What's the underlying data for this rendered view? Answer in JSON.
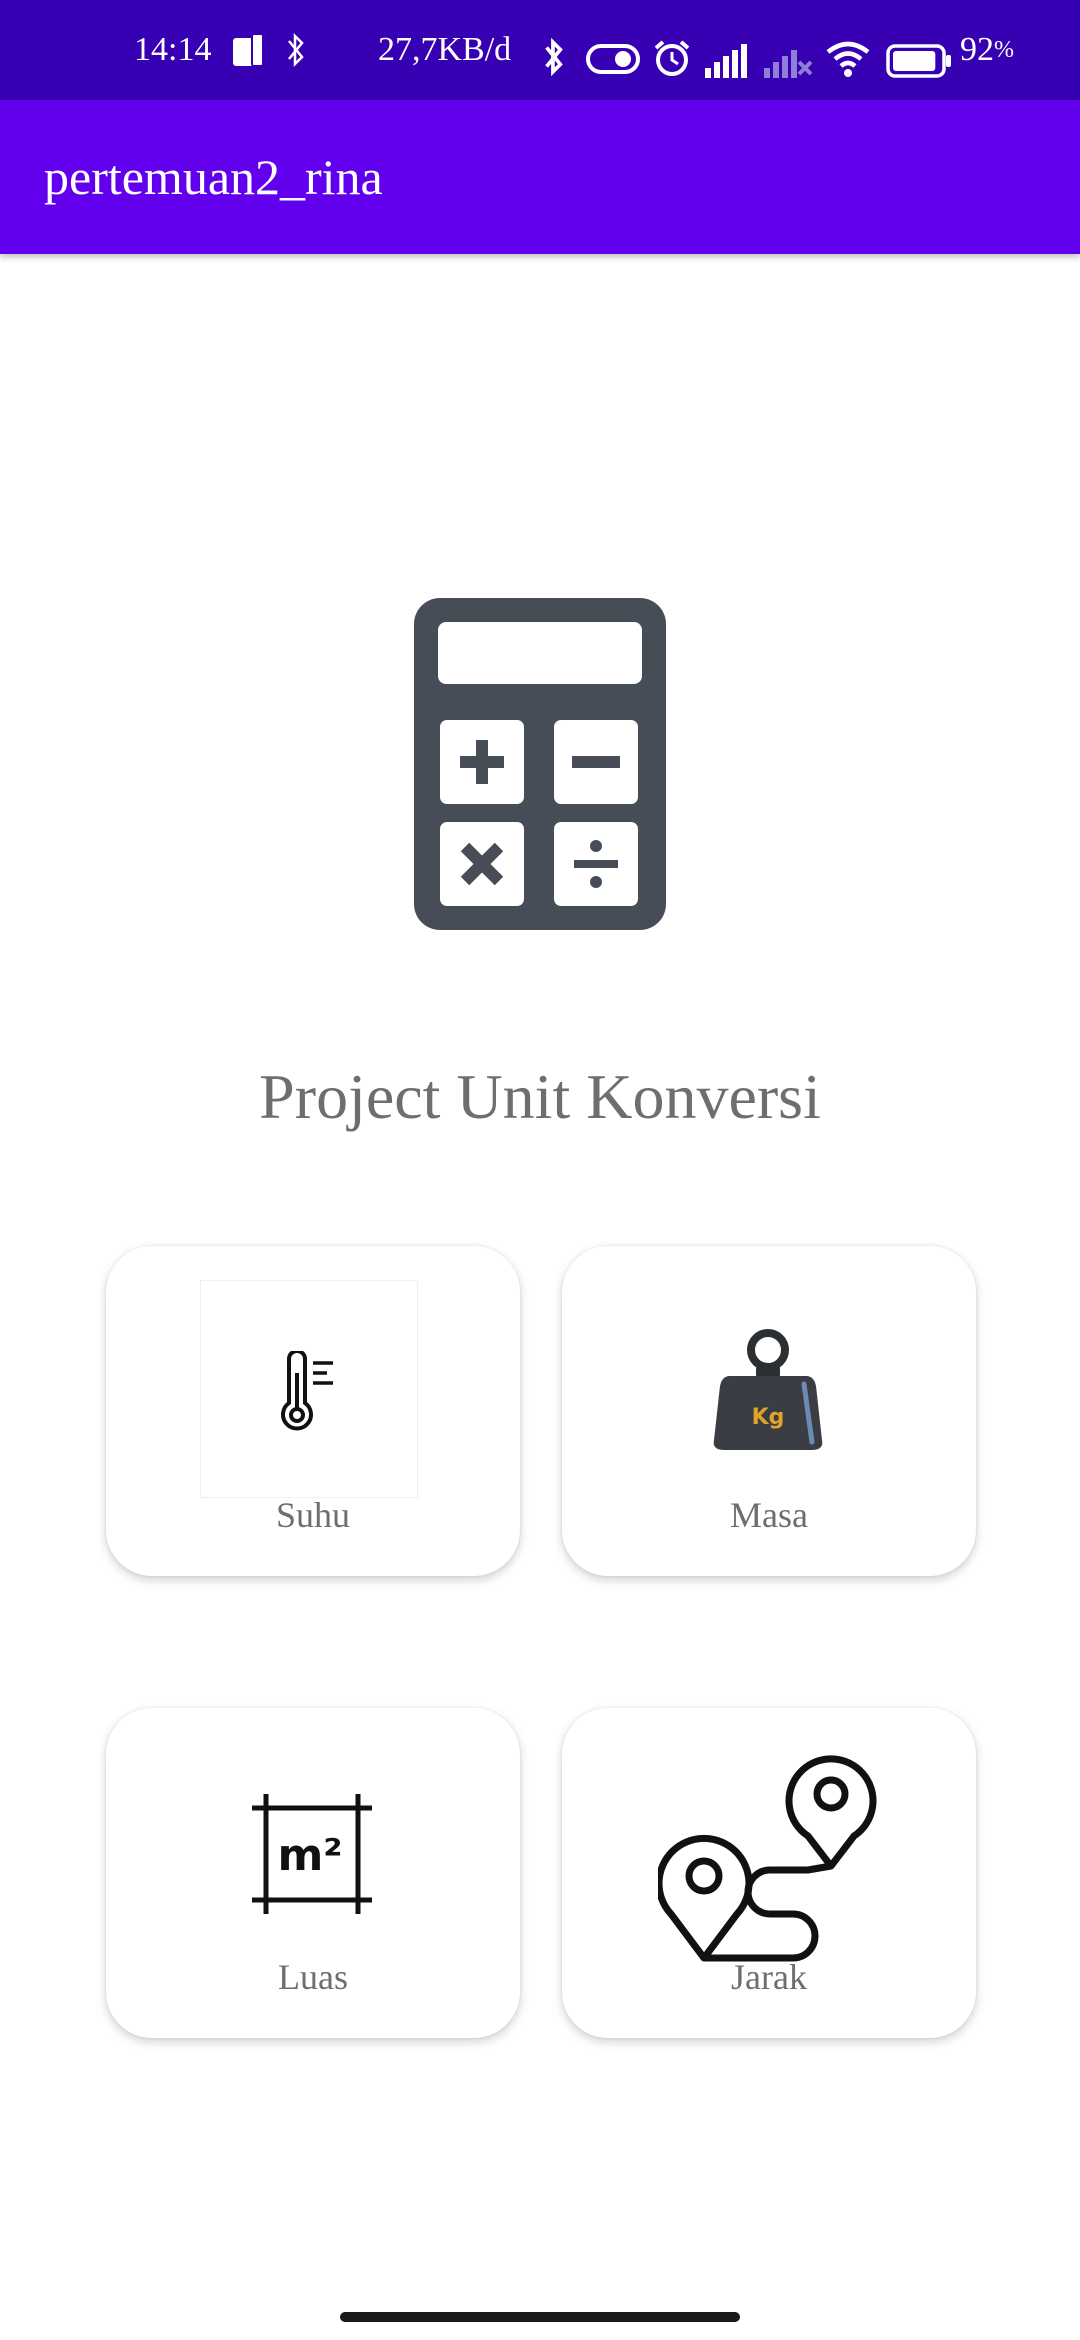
{
  "status_bar": {
    "time": "14:14",
    "network_speed": "27,7KB/d",
    "battery_percent": "92",
    "battery_unit": "%",
    "battery_level": 0.92,
    "icons": [
      "phone-icon",
      "bluetooth-icon",
      "bluetooth-icon",
      "toggle-icon",
      "alarm-icon",
      "signal-icon",
      "signal-icon",
      "wifi-icon",
      "battery-icon"
    ],
    "background": "#3700B3"
  },
  "app_bar": {
    "title": "pertemuan2_rina",
    "background": "#6200EE"
  },
  "main": {
    "hero_icon": "calculator-icon",
    "project_title": "Project Unit Konversi",
    "title_color": "#6e6e6e"
  },
  "cards": [
    {
      "label": "Suhu",
      "icon": "thermometer-icon"
    },
    {
      "label": "Masa",
      "icon": "weight-icon",
      "icon_text": "Kg"
    },
    {
      "label": "Luas",
      "icon": "area-icon",
      "icon_text": "m²"
    },
    {
      "label": "Jarak",
      "icon": "route-icon"
    }
  ]
}
